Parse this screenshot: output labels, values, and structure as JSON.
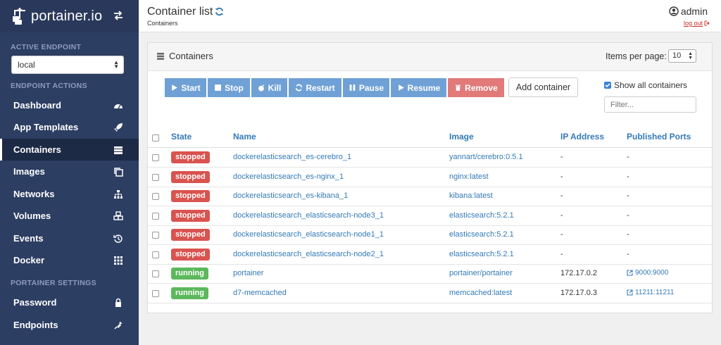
{
  "sidebar": {
    "brand": "portainer.io",
    "active_endpoint_title": "ACTIVE ENDPOINT",
    "endpoint_value": "local",
    "endpoint_actions_title": "ENDPOINT ACTIONS",
    "settings_title": "PORTAINER SETTINGS",
    "items": [
      {
        "label": "Dashboard",
        "icon": "dashboard-icon"
      },
      {
        "label": "App Templates",
        "icon": "rocket-icon"
      },
      {
        "label": "Containers",
        "icon": "server-icon",
        "active": true
      },
      {
        "label": "Images",
        "icon": "clone-icon"
      },
      {
        "label": "Networks",
        "icon": "sitemap-icon"
      },
      {
        "label": "Volumes",
        "icon": "cubes-icon"
      },
      {
        "label": "Events",
        "icon": "history-icon"
      },
      {
        "label": "Docker",
        "icon": "th-icon"
      }
    ],
    "settings_items": [
      {
        "label": "Password",
        "icon": "lock-icon"
      },
      {
        "label": "Endpoints",
        "icon": "plug-icon"
      }
    ]
  },
  "header": {
    "title": "Container list",
    "breadcrumb": "Containers",
    "username": "admin",
    "logout": "log out"
  },
  "panel": {
    "title": "Containers",
    "items_per_page_label": "Items per page:",
    "items_per_page_value": "10",
    "buttons": {
      "start": "Start",
      "stop": "Stop",
      "kill": "Kill",
      "restart": "Restart",
      "pause": "Pause",
      "resume": "Resume",
      "remove": "Remove",
      "add": "Add container"
    },
    "show_all_label": "Show all containers",
    "filter_placeholder": "Filter...",
    "columns": {
      "state": "State",
      "name": "Name",
      "image": "Image",
      "ip": "IP Address",
      "ports": "Published Ports"
    },
    "rows": [
      {
        "state": "stopped",
        "name": "dockerelasticsearch_es-cerebro_1",
        "image": "yannart/cerebro:0.5.1",
        "ip": "-",
        "ports": "-"
      },
      {
        "state": "stopped",
        "name": "dockerelasticsearch_es-nginx_1",
        "image": "nginx:latest",
        "ip": "-",
        "ports": "-"
      },
      {
        "state": "stopped",
        "name": "dockerelasticsearch_es-kibana_1",
        "image": "kibana:latest",
        "ip": "-",
        "ports": "-"
      },
      {
        "state": "stopped",
        "name": "dockerelasticsearch_elasticsearch-node3_1",
        "image": "elasticsearch:5.2.1",
        "ip": "-",
        "ports": "-"
      },
      {
        "state": "stopped",
        "name": "dockerelasticsearch_elasticsearch-node1_1",
        "image": "elasticsearch:5.2.1",
        "ip": "-",
        "ports": "-"
      },
      {
        "state": "stopped",
        "name": "dockerelasticsearch_elasticsearch-node2_1",
        "image": "elasticsearch:5.2.1",
        "ip": "-",
        "ports": "-"
      },
      {
        "state": "running",
        "name": "portainer",
        "image": "portainer/portainer",
        "ip": "172.17.0.2",
        "ports": "9000:9000"
      },
      {
        "state": "running",
        "name": "d7-memcached",
        "image": "memcached:latest",
        "ip": "172.17.0.3",
        "ports": "11211:11211"
      }
    ]
  },
  "colors": {
    "sidebar_bg": "#2d3e63",
    "primary": "#70a1d6",
    "danger": "#e17a79",
    "stopped": "#d9534f",
    "running": "#5cb85c",
    "link": "#337ab7"
  }
}
